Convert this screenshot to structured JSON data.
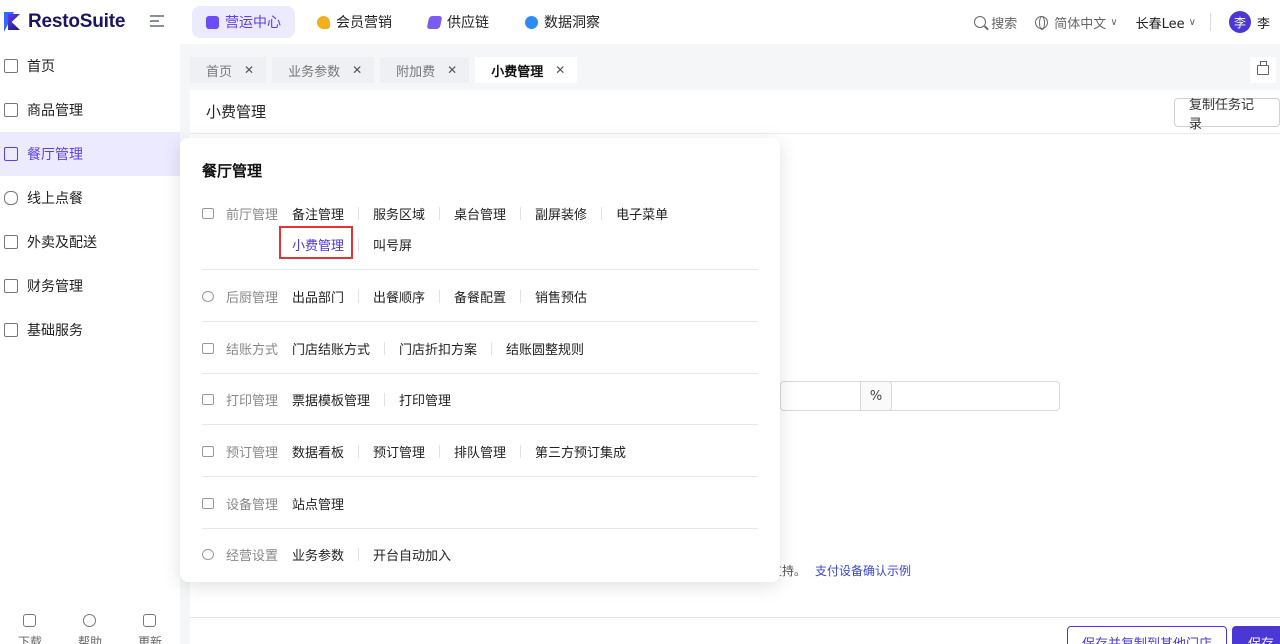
{
  "app": {
    "logo_text": "RestoSuite"
  },
  "topnav": [
    {
      "label": "营运中心",
      "active": true,
      "color": "#6a4df5"
    },
    {
      "label": "会员营销",
      "active": false,
      "color": "#f2b01e"
    },
    {
      "label": "供应链",
      "active": false,
      "color": "#7a5cf0"
    },
    {
      "label": "数据洞察",
      "active": false,
      "color": "#2c8cf4"
    }
  ],
  "topright": {
    "search": "搜索",
    "language": "简体中文",
    "user": "长春Lee",
    "avatar": "李",
    "avatar_name": "李"
  },
  "sidebar": {
    "items": [
      {
        "label": "首页",
        "icon": "home-icon"
      },
      {
        "label": "商品管理",
        "icon": "box-icon"
      },
      {
        "label": "餐厅管理",
        "icon": "store-icon",
        "active": true
      },
      {
        "label": "线上点餐",
        "icon": "hand-icon"
      },
      {
        "label": "外卖及配送",
        "icon": "bag-icon"
      },
      {
        "label": "财务管理",
        "icon": "folder-icon"
      },
      {
        "label": "基础服务",
        "icon": "grid-icon"
      }
    ],
    "bottom": [
      {
        "label": "下载",
        "icon": "download-icon"
      },
      {
        "label": "帮助",
        "icon": "help-icon"
      },
      {
        "label": "更新",
        "icon": "update-icon"
      }
    ]
  },
  "tabs": [
    {
      "label": "首页",
      "active": false
    },
    {
      "label": "业务参数",
      "active": false
    },
    {
      "label": "附加费",
      "active": false
    },
    {
      "label": "小费管理",
      "active": true
    }
  ],
  "main": {
    "title": "小费管理",
    "copy_button": "复制任务记录",
    "percent_suffix": "%",
    "note_tail": "支持。",
    "note_link": "支付设备确认示例",
    "save_copy_button": "保存并复制到其他门店",
    "save_button": "保存"
  },
  "popup": {
    "title": "餐厅管理",
    "groups": [
      {
        "label": "前厅管理",
        "icon": "frontdesk-icon",
        "links": [
          [
            "备注管理",
            "服务区域",
            "桌台管理",
            "副屏装修",
            "电子菜单"
          ],
          [
            "小费管理",
            "叫号屏"
          ]
        ]
      },
      {
        "label": "后厨管理",
        "icon": "chef-icon",
        "links": [
          [
            "出品部门",
            "出餐顺序",
            "备餐配置",
            "销售预估"
          ]
        ]
      },
      {
        "label": "结账方式",
        "icon": "checkout-icon",
        "links": [
          [
            "门店结账方式",
            "门店折扣方案",
            "结账圆整规则"
          ]
        ]
      },
      {
        "label": "打印管理",
        "icon": "printer-icon",
        "links": [
          [
            "票据模板管理",
            "打印管理"
          ]
        ]
      },
      {
        "label": "预订管理",
        "icon": "reservation-icon",
        "links": [
          [
            "数据看板",
            "预订管理",
            "排队管理",
            "第三方预订集成"
          ]
        ]
      },
      {
        "label": "设备管理",
        "icon": "device-icon",
        "links": [
          [
            "站点管理"
          ]
        ]
      },
      {
        "label": "经营设置",
        "icon": "settings-icon",
        "links": [
          [
            "业务参数",
            "开台自动加入"
          ]
        ]
      }
    ],
    "active_link": "小费管理"
  }
}
